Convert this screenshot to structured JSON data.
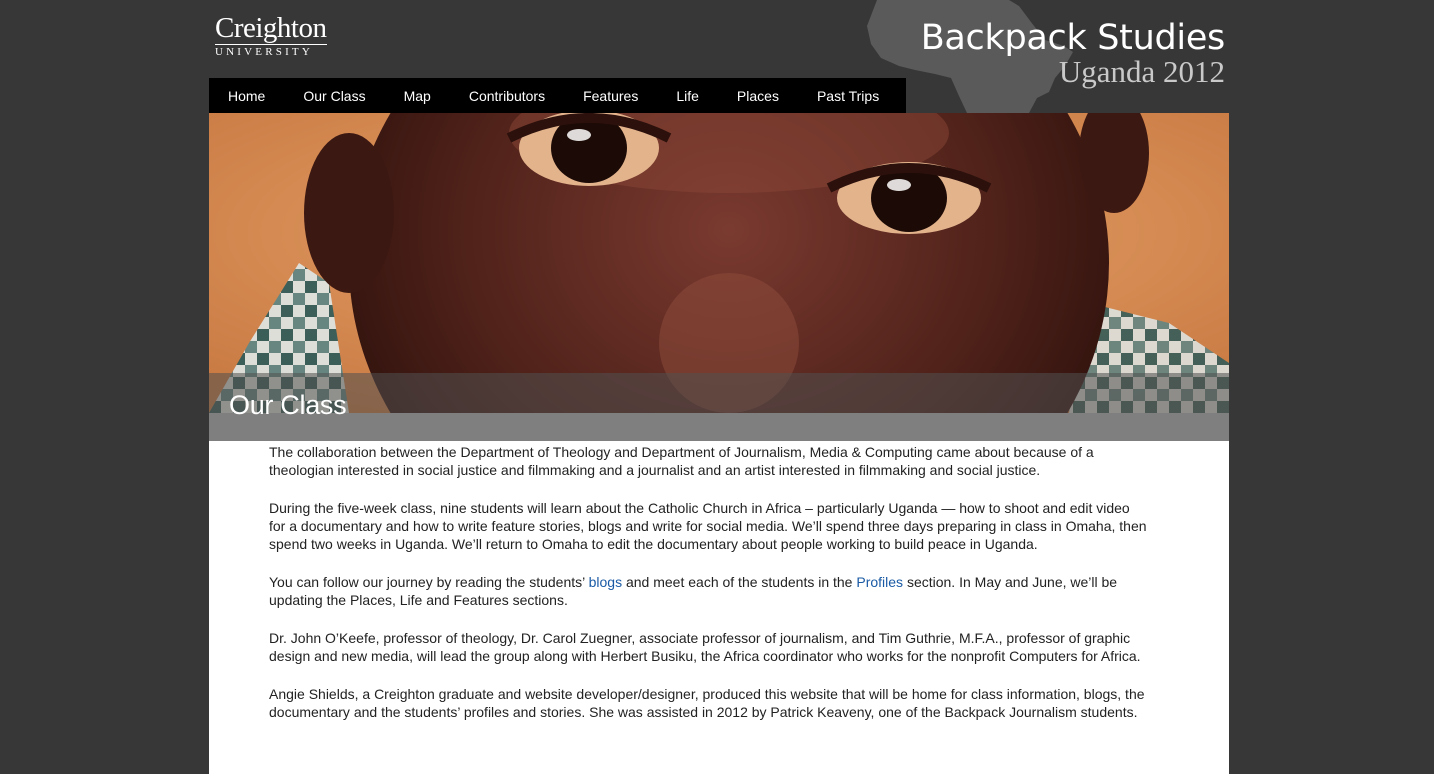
{
  "header": {
    "logo_main": "Creighton",
    "logo_sub": "UNIVERSITY",
    "site_title": "Backpack Studies",
    "site_subtitle": "Uganda 2012"
  },
  "nav": {
    "items": [
      {
        "label": "Home"
      },
      {
        "label": "Our Class"
      },
      {
        "label": "Map"
      },
      {
        "label": "Contributors"
      },
      {
        "label": "Features"
      },
      {
        "label": "Life"
      },
      {
        "label": "Places"
      },
      {
        "label": "Past Trips"
      }
    ]
  },
  "page": {
    "title": "Our Class"
  },
  "content": {
    "p1": "The collaboration between the Department of Theology and Department of Journalism, Media & Computing came about because of a theologian interested in social justice and filmmaking and a journalist and an artist interested in filmmaking and social justice.",
    "p2": "During the five-week class, nine students will learn about the Catholic Church in Africa – particularly Uganda — how to shoot and edit video for a documentary and how to write feature stories, blogs and write for social media.  We’ll spend three days preparing in class in Omaha, then spend two weeks in Uganda. We’ll return to Omaha to edit the documentary about people working to build peace in Uganda.",
    "p3_before": "You can follow our journey by reading the students’ ",
    "p3_link1": "blogs",
    "p3_middle": " and meet each of the students in the ",
    "p3_link2": "Profiles",
    "p3_after": " section. In May and June, we’ll be updating the Places, Life and Features sections.",
    "p4": "Dr. John O’Keefe, professor of theology, Dr. Carol Zuegner, associate professor of journalism, and Tim Guthrie, M.F.A.,  professor of graphic design and new media, will lead the group along with Herbert  Busiku, the Africa coordinator who works for the nonprofit Computers for Africa.",
    "p5": "Angie Shields, a Creighton graduate and website developer/designer, produced this website that will be home for class information, blogs, the documentary and the students’ profiles and stories. She was assisted in 2012 by Patrick Keaveny, one of the Backpack Journalism students."
  },
  "colors": {
    "background": "#373737",
    "nav_background": "#000000",
    "link": "#1a5aa5",
    "title_band": "#7f7f7f"
  }
}
